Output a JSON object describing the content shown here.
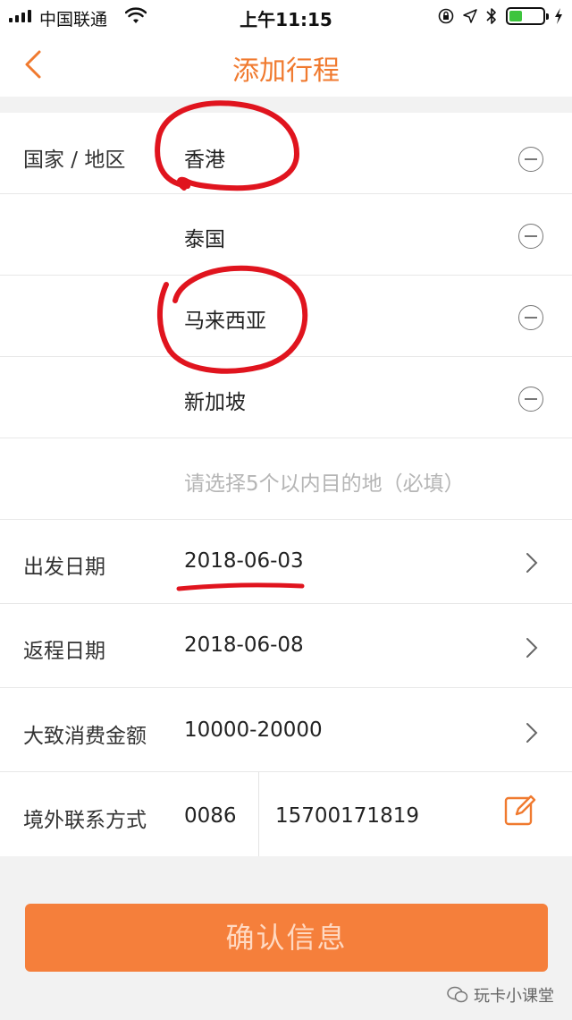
{
  "status_bar": {
    "carrier": "中国联通",
    "time": "上午11:15",
    "battery_level": 0.4,
    "battery_color": "#3dc43d"
  },
  "nav": {
    "title": "添加行程",
    "accent_color": "#f07a2f"
  },
  "destinations": {
    "label": "国家 / 地区",
    "items": [
      "香港",
      "泰国",
      "马来西亚",
      "新加坡"
    ],
    "placeholder": "请选择5个以内目的地（必填）"
  },
  "departure": {
    "label": "出发日期",
    "value": "2018-06-03"
  },
  "return": {
    "label": "返程日期",
    "value": "2018-06-08"
  },
  "budget": {
    "label": "大致消费金额",
    "value": "10000-20000"
  },
  "contact": {
    "label": "境外联系方式",
    "country_code": "0086",
    "phone": "15700171819"
  },
  "confirm_button": {
    "label": "确认信息",
    "color": "#f57f3b"
  },
  "watermark": {
    "text": "玩卡小课堂"
  }
}
